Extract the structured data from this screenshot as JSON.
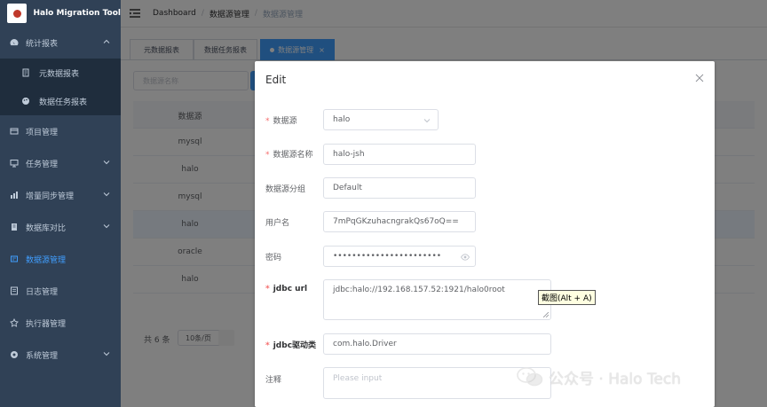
{
  "app": {
    "title": "Halo Migration Tool"
  },
  "sidebar": {
    "items": [
      {
        "label": "统计报表",
        "icon": "dashboard-icon",
        "expanded": true
      },
      {
        "label": "项目管理",
        "icon": "project-icon"
      },
      {
        "label": "任务管理",
        "icon": "monitor-icon"
      },
      {
        "label": "增量同步管理",
        "icon": "sync-icon"
      },
      {
        "label": "数据库对比",
        "icon": "compare-icon"
      },
      {
        "label": "数据源管理",
        "icon": "datasource-icon",
        "active": true
      },
      {
        "label": "日志管理",
        "icon": "log-icon"
      },
      {
        "label": "执行器管理",
        "icon": "executor-icon"
      },
      {
        "label": "系统管理",
        "icon": "system-icon"
      }
    ],
    "subitems": [
      {
        "label": "元数据报表",
        "icon": "report-icon"
      },
      {
        "label": "数据任务报表",
        "icon": "palette-icon"
      }
    ]
  },
  "breadcrumb": {
    "items": [
      "Dashboard",
      "数据源管理",
      "数据源管理"
    ]
  },
  "tags": [
    {
      "label": "元数据报表"
    },
    {
      "label": "数据任务报表"
    },
    {
      "label": "数据源管理",
      "active": true,
      "close": "×"
    }
  ],
  "filters": {
    "name_placeholder": "数据源名称"
  },
  "table": {
    "header": "数据源",
    "rows": [
      "mysql",
      "halo",
      "mysql",
      "halo",
      "oracle",
      "halo"
    ],
    "highlighted_row": 3
  },
  "pager": {
    "total": "共 6 条",
    "page_size": "10条/页"
  },
  "dialog": {
    "title": "Edit",
    "fields": {
      "datasource": {
        "label": "数据源",
        "value": "halo",
        "required": true
      },
      "name": {
        "label": "数据源名称",
        "value": "halo-jsh",
        "required": true
      },
      "group": {
        "label": "数据源分组",
        "value": "Default"
      },
      "username": {
        "label": "用户名",
        "value": "7mPqGKzuhacngrakQs67oQ=="
      },
      "password": {
        "label": "密码",
        "value": "•••••••••••••••••••••••"
      },
      "jdbc_url": {
        "label": "jdbc url",
        "value": "jdbc:halo://192.168.157.52:1921/halo0root",
        "required": true
      },
      "jdbc_driver": {
        "label": "jdbc驱动类",
        "value": "com.halo.Driver",
        "required": true
      },
      "comment": {
        "label": "注释",
        "placeholder": "Please input"
      }
    }
  },
  "tooltip": {
    "text": "截图(Alt + A)"
  },
  "watermark": {
    "text": "公众号 · Halo Tech"
  },
  "colors": {
    "sidebar": "#304156",
    "accent": "#409eff",
    "required": "#f56c6c"
  }
}
